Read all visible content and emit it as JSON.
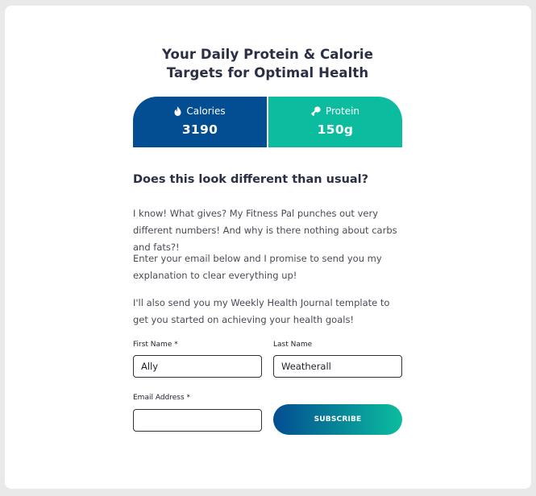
{
  "heading": "Your Daily Protein & Calorie Targets for Optimal Health",
  "stats": {
    "calories": {
      "label": "Calories",
      "value": "3190",
      "icon": "flame-icon",
      "color": "#034d92"
    },
    "protein": {
      "label": "Protein",
      "value": "150g",
      "icon": "drumstick-icon",
      "color": "#0bbd9e"
    }
  },
  "subheading": "Does this look different than usual?",
  "paragraphs": [
    "I know! What gives? My Fitness Pal punches out very different numbers! And why is there nothing about carbs and fats?!",
    "Enter your email below and I promise to send you my explanation to clear everything up!",
    "I'll also send you my Weekly Health Journal template to get you started on achieving your health goals!"
  ],
  "form": {
    "first_name": {
      "label": "First Name *",
      "value": "Ally"
    },
    "last_name": {
      "label": "Last Name",
      "value": "Weatherall"
    },
    "email": {
      "label": "Email Address *",
      "value": ""
    },
    "subscribe_label": "SUBSCRIBE"
  }
}
